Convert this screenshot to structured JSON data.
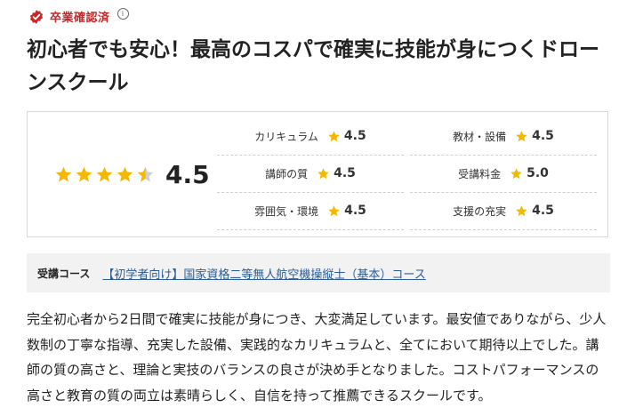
{
  "badge": {
    "label": "卒業確認済",
    "info": "i",
    "color": "#c62828"
  },
  "title": "初心者でも安心！最高のコスパで確実に技能が身につくドローンスクール",
  "overall": {
    "rating": 4.5,
    "score_text": "4.5"
  },
  "categories": [
    {
      "label": "カリキュラム",
      "score": "4.5"
    },
    {
      "label": "教材・設備",
      "score": "4.5"
    },
    {
      "label": "講師の質",
      "score": "4.5"
    },
    {
      "label": "受講料金",
      "score": "5.0"
    },
    {
      "label": "雰囲気・環境",
      "score": "4.5"
    },
    {
      "label": "支援の充実",
      "score": "4.5"
    }
  ],
  "course": {
    "label": "受講コース",
    "link_text": "【初学者向け】国家資格二等無人航空機操縦士（基本）コース"
  },
  "review": "完全初心者から2日間で確実に技能が身につき、大変満足しています。最安値でありながら、少人数制の丁寧な指導、充実した設備、実践的なカリキュラムと、全てにおいて期待以上でした。講師の質の高さと、理論と実技のバランスの良さが決め手となりました。コストパフォーマンスの高さと教育の質の両立は素晴らしく、自信を持って推薦できるスクールです。",
  "colors": {
    "star": "#f5b800",
    "star_empty": "#cfcfcf",
    "link": "#2b5d94",
    "course_bg": "#f2f2f2"
  }
}
